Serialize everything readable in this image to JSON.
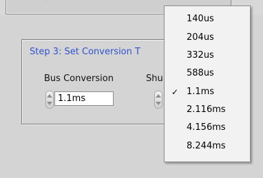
{
  "step": {
    "title": "Step 3: Set Conversion T",
    "bus_label": "Bus Conversion",
    "shunt_label": "Shu",
    "bus_value": "1.1ms"
  },
  "dropdown": {
    "options": [
      {
        "label": "140us",
        "selected": false
      },
      {
        "label": "204us",
        "selected": false
      },
      {
        "label": "332us",
        "selected": false
      },
      {
        "label": "588us",
        "selected": false
      },
      {
        "label": "1.1ms",
        "selected": true
      },
      {
        "label": "2.116ms",
        "selected": false
      },
      {
        "label": "4.156ms",
        "selected": false
      },
      {
        "label": "8.244ms",
        "selected": false
      }
    ],
    "check_mark": "✓"
  },
  "colors": {
    "title_blue": "#2f54d0",
    "panel_bg": "#d4d4d4",
    "menu_bg": "#f2f2f2"
  }
}
